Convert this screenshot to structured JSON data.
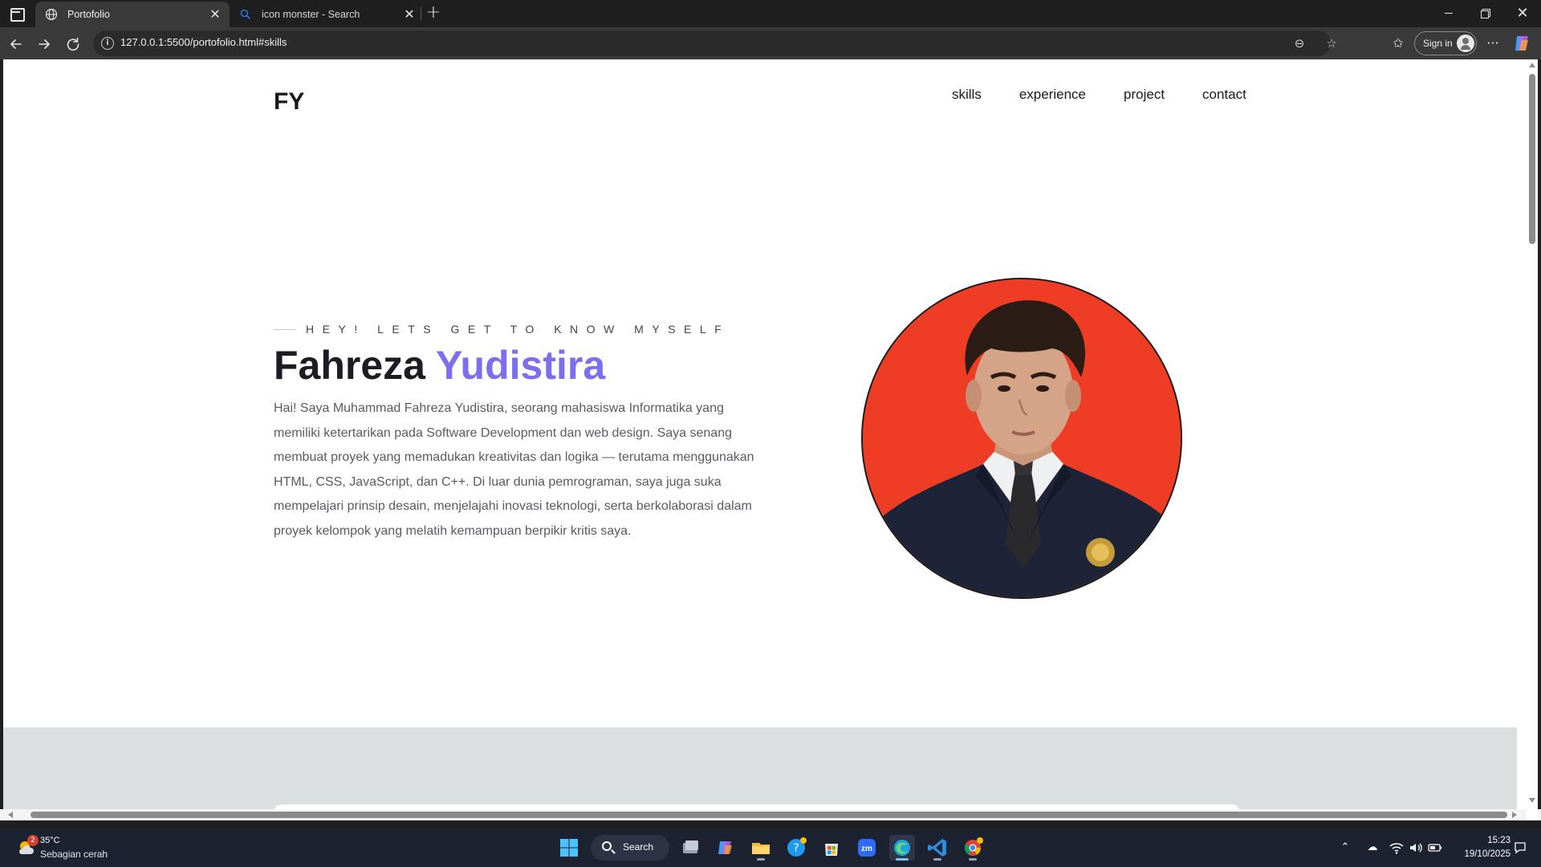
{
  "browser": {
    "tabs": [
      {
        "title": "Portofolio",
        "active": true
      },
      {
        "title": "icon monster - Search",
        "active": false
      }
    ],
    "url": "127.0.0.1:5500/portofolio.html#skills",
    "signin_label": "Sign in"
  },
  "page": {
    "logo": "FY",
    "nav": [
      "skills",
      "experience",
      "project",
      "contact"
    ],
    "hero": {
      "subtitle": "HEY! LETS GET TO KNOW MYSELF",
      "first_name": "Fahreza",
      "last_name": "Yudistira",
      "description": "Hai! Saya Muhammad Fahreza Yudistira, seorang mahasiswa Informatika yang memiliki ketertarikan pada Software Development dan web design. Saya senang membuat proyek yang memadukan kreativitas dan logika — terutama menggunakan HTML, CSS, JavaScript, dan C++. Di luar dunia pemrograman, saya juga suka mempelajari prinsip desain, menjelajahi inovasi teknologi, serta berkolaborasi dalam proyek kelompok yang melatih kemampuan berpikir kritis saya."
    },
    "colors": {
      "accent": "#7b6ef0",
      "photo_bg": "#ee3d24",
      "skills_band": "#dcdfe0"
    }
  },
  "taskbar": {
    "weather": {
      "badge": "2",
      "temp": "35°C",
      "condition": "Sebagian cerah"
    },
    "search_label": "Search",
    "apps": [
      "task-view-icon",
      "copilot-icon",
      "file-explorer-icon",
      "help-icon",
      "store-icon",
      "zoom-icon",
      "edge-icon",
      "vscode-icon",
      "chrome-icon"
    ],
    "zoom_label": "zm",
    "time": "15:23",
    "date": "19/10/2025"
  }
}
